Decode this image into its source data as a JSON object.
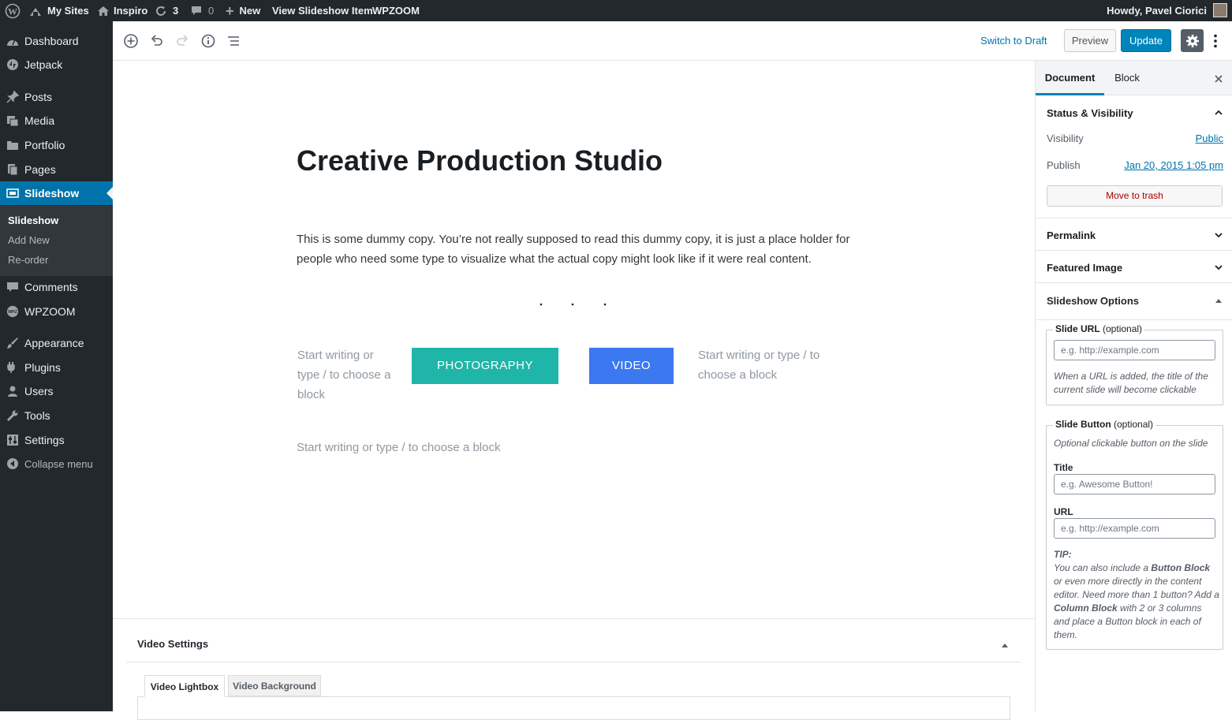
{
  "admin_bar": {
    "my_sites": "My Sites",
    "site": "Inspiro",
    "updates": "3",
    "comments": "0",
    "new": "New",
    "view": "View Slideshow Item",
    "wpzoom": "WPZOOM",
    "howdy": "Howdy, Pavel Ciorici"
  },
  "sidebar": {
    "items": [
      {
        "label": "Dashboard",
        "icon": "dashboard-icon"
      },
      {
        "label": "Jetpack",
        "icon": "jetpack-icon"
      },
      {
        "label": "Posts",
        "icon": "pin-icon"
      },
      {
        "label": "Media",
        "icon": "media-icon"
      },
      {
        "label": "Portfolio",
        "icon": "folder-icon"
      },
      {
        "label": "Pages",
        "icon": "pages-icon"
      },
      {
        "label": "Slideshow",
        "icon": "slides-icon"
      },
      {
        "label": "Comments",
        "icon": "comment-icon"
      },
      {
        "label": "WPZOOM",
        "icon": "wpzoom-icon"
      },
      {
        "label": "Appearance",
        "icon": "brush-icon"
      },
      {
        "label": "Plugins",
        "icon": "plugin-icon"
      },
      {
        "label": "Users",
        "icon": "user-icon"
      },
      {
        "label": "Tools",
        "icon": "wrench-icon"
      },
      {
        "label": "Settings",
        "icon": "settings-icon"
      },
      {
        "label": "Collapse menu",
        "icon": "collapse-icon"
      }
    ],
    "submenu": [
      "Slideshow",
      "Add New",
      "Re-order"
    ]
  },
  "toolbar": {
    "switch_draft": "Switch to Draft",
    "preview": "Preview",
    "update": "Update"
  },
  "editor": {
    "title": "Creative Production Studio",
    "paragraph": "This is some dummy copy. You’re not really supposed to read this dummy copy, it is just a place holder for people who need some type to visualize what the actual copy might look like if it were real content.",
    "col1_placeholder": "Start writing or type / to choose a block",
    "btn_photography": "PHOTOGRAPHY",
    "btn_video": "VIDEO",
    "col4_placeholder": "Start writing or type / to choose a block",
    "bottom_placeholder": "Start writing or type / to choose a block"
  },
  "video_settings": {
    "title": "Video Settings",
    "tabs": [
      "Video Lightbox",
      "Video Background"
    ]
  },
  "panel": {
    "tab_document": "Document",
    "tab_block": "Block",
    "status_title": "Status & Visibility",
    "visibility_label": "Visibility",
    "visibility_value": "Public",
    "publish_label": "Publish",
    "publish_value": "Jan 20, 2015 1:05 pm",
    "trash": "Move to trash",
    "permalink": "Permalink",
    "featured": "Featured Image",
    "slideshow_options": "Slideshow Options",
    "slide_url_legend": "Slide URL",
    "optional": "(optional)",
    "slide_url_placeholder": "e.g. http://example.com",
    "slide_url_help": "When a URL is added, the title of the current slide will become clickable",
    "slide_button_legend": "Slide Button",
    "slide_button_desc": "Optional clickable button on the slide",
    "title_label": "Title",
    "title_placeholder": "e.g. Awesome Button!",
    "url_label": "URL",
    "url_placeholder": "e.g. http://example.com",
    "tip_label": "TIP:",
    "tip_1": "You can also include a ",
    "tip_2": "Button Block",
    "tip_3": " or even more directly in the content editor. Need more than 1 button? Add a ",
    "tip_4": "Column Block",
    "tip_5": " with 2 or 3 columns and place a Button block in each of them."
  },
  "colors": {
    "admin_dark": "#23282d",
    "wp_blue": "#0073aa",
    "photography_btn": "#1fb5a8",
    "video_btn": "#3c78f0"
  }
}
